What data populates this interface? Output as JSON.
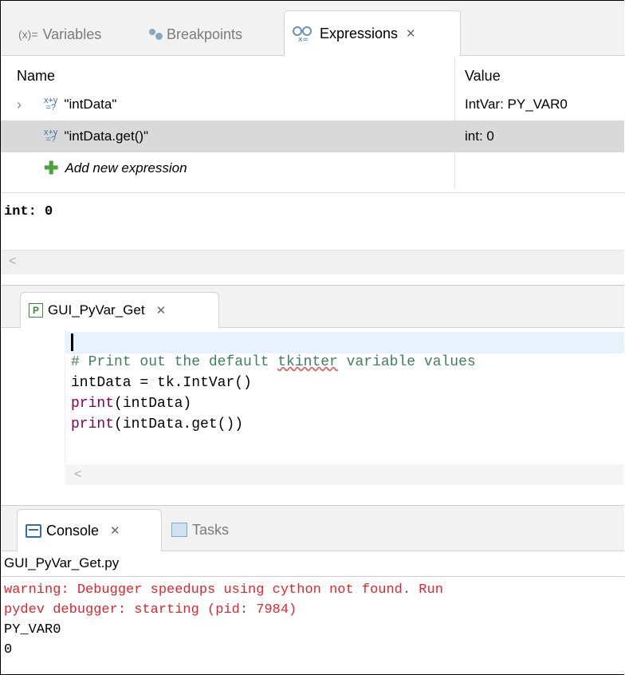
{
  "expressions_view": {
    "tabs": [
      {
        "prefix": "(x)=",
        "label": "Variables"
      },
      {
        "label": "Breakpoints"
      },
      {
        "label": "Expressions",
        "close": "✕"
      }
    ],
    "columns": {
      "name": "Name",
      "value": "Value"
    },
    "rows": [
      {
        "name": "\"intData\"",
        "value": "IntVar: PY_VAR0",
        "expandable": true
      },
      {
        "name": "\"intData.get()\"",
        "value": "int: 0",
        "selected": true
      }
    ],
    "add_label": "Add new expression",
    "detail_text": "int: 0",
    "scroll_left": "<"
  },
  "editor": {
    "tab_label": "GUI_PyVar_Get",
    "tab_close": "✕",
    "lines": [
      {
        "text": "# Print out the default ",
        "squiggle": "tkinter",
        "rest": " variable values",
        "kind": "comment"
      },
      {
        "text": "intData = tk.IntVar()",
        "kind": "code"
      },
      {
        "fn": "print",
        "args": "(intData)",
        "kind": "call"
      },
      {
        "fn": "print",
        "args": "(intData.get())",
        "kind": "call"
      }
    ],
    "scroll_left": "<"
  },
  "console": {
    "tabs": [
      {
        "label": "Console",
        "close": "✕"
      },
      {
        "label": "Tasks"
      }
    ],
    "title": "GUI_PyVar_Get.py",
    "lines": [
      {
        "text": "warning: Debugger speedups using cython not found. Run",
        "color": "#e0242a"
      },
      {
        "text": "pydev debugger: starting (pid: 7984)",
        "color": "#e0242a"
      },
      {
        "text": "PY_VAR0",
        "color": "#000000"
      },
      {
        "text": "0",
        "color": "#000000"
      }
    ]
  },
  "colors": {
    "selection": "#d9d9d9",
    "current_line": "#e8f2fe",
    "comment": "#3f7f5f",
    "keyword": "#7f0055",
    "error": "#e0242a"
  }
}
